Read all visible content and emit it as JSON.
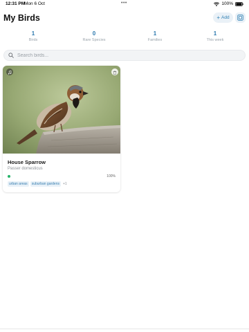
{
  "status_bar": {
    "time": "12:31 PM",
    "date": "Mon 6 Oct",
    "dots": "•••",
    "battery": "100%",
    "icons": [
      "wifi-icon",
      "battery-icon"
    ]
  },
  "header": {
    "title": "My Birds",
    "add_label": "Add",
    "add_icon": "plus-icon",
    "toggle_icon": "view-toggle-icon"
  },
  "stats": [
    {
      "value": "1",
      "label": "Birds"
    },
    {
      "value": "0",
      "label": "Rare Species"
    },
    {
      "value": "1",
      "label": "Families"
    },
    {
      "value": "1",
      "label": "This week"
    }
  ],
  "search": {
    "placeholder": "Search birds...",
    "value": "",
    "icon": "search-icon"
  },
  "birds": [
    {
      "name": "House Sparrow",
      "scientific_name": "Passer domesticus",
      "confidence": "100%",
      "status_color": "#27b36a",
      "tags": [
        "urban areas",
        "suburban gardens"
      ],
      "more_tags": "+1",
      "photo": "sparrow-photo",
      "badges": [
        "music-note-icon",
        "trash-icon"
      ]
    }
  ],
  "colors": {
    "accent": "#2a78ad",
    "add_bg": "#eaf1f7",
    "tag_bg": "#e8f1f8",
    "tag_text": "#3a7fb0"
  }
}
